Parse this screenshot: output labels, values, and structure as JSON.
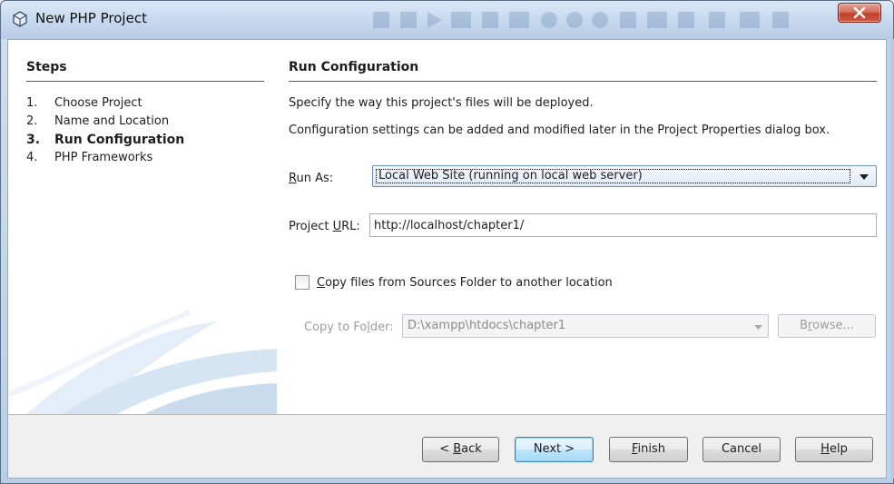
{
  "window": {
    "title": "New PHP Project"
  },
  "steps": {
    "title": "Steps",
    "items": [
      {
        "num": "1.",
        "label": "Choose Project",
        "active": false
      },
      {
        "num": "2.",
        "label": "Name and Location",
        "active": false
      },
      {
        "num": "3.",
        "label": "Run Configuration",
        "active": true
      },
      {
        "num": "4.",
        "label": "PHP Frameworks",
        "active": false
      }
    ]
  },
  "run_config": {
    "title": "Run Configuration",
    "desc1": "Specify the way this project's files will be deployed.",
    "desc2": "Configuration settings can be added and modified later in the Project Properties dialog box.",
    "run_as_label": "Run As:",
    "run_as_value": "Local Web Site (running on local web server)",
    "project_url_label": "Project URL:",
    "project_url_value": "http://localhost/chapter1/",
    "copy_files_label": "Copy files from Sources Folder to another location",
    "copy_files_checked": false,
    "copy_to_folder_label": "Copy to Folder:",
    "copy_to_folder_value": "D:\\xampp\\htdocs\\chapter1",
    "browse_label": "Browse..."
  },
  "buttons": {
    "back": "< Back",
    "next": "Next >",
    "finish": "Finish",
    "cancel": "Cancel",
    "help": "Help"
  },
  "colors": {
    "titlebar": "#c5d8ee",
    "close_button": "#c0402b",
    "default_button_border": "#3c7fb1",
    "footer_bg": "#f0f0f0"
  },
  "icons": {
    "title": "netbeans-project-icon",
    "close": "close-x-icon",
    "dropdown": "chevron-down-icon"
  }
}
